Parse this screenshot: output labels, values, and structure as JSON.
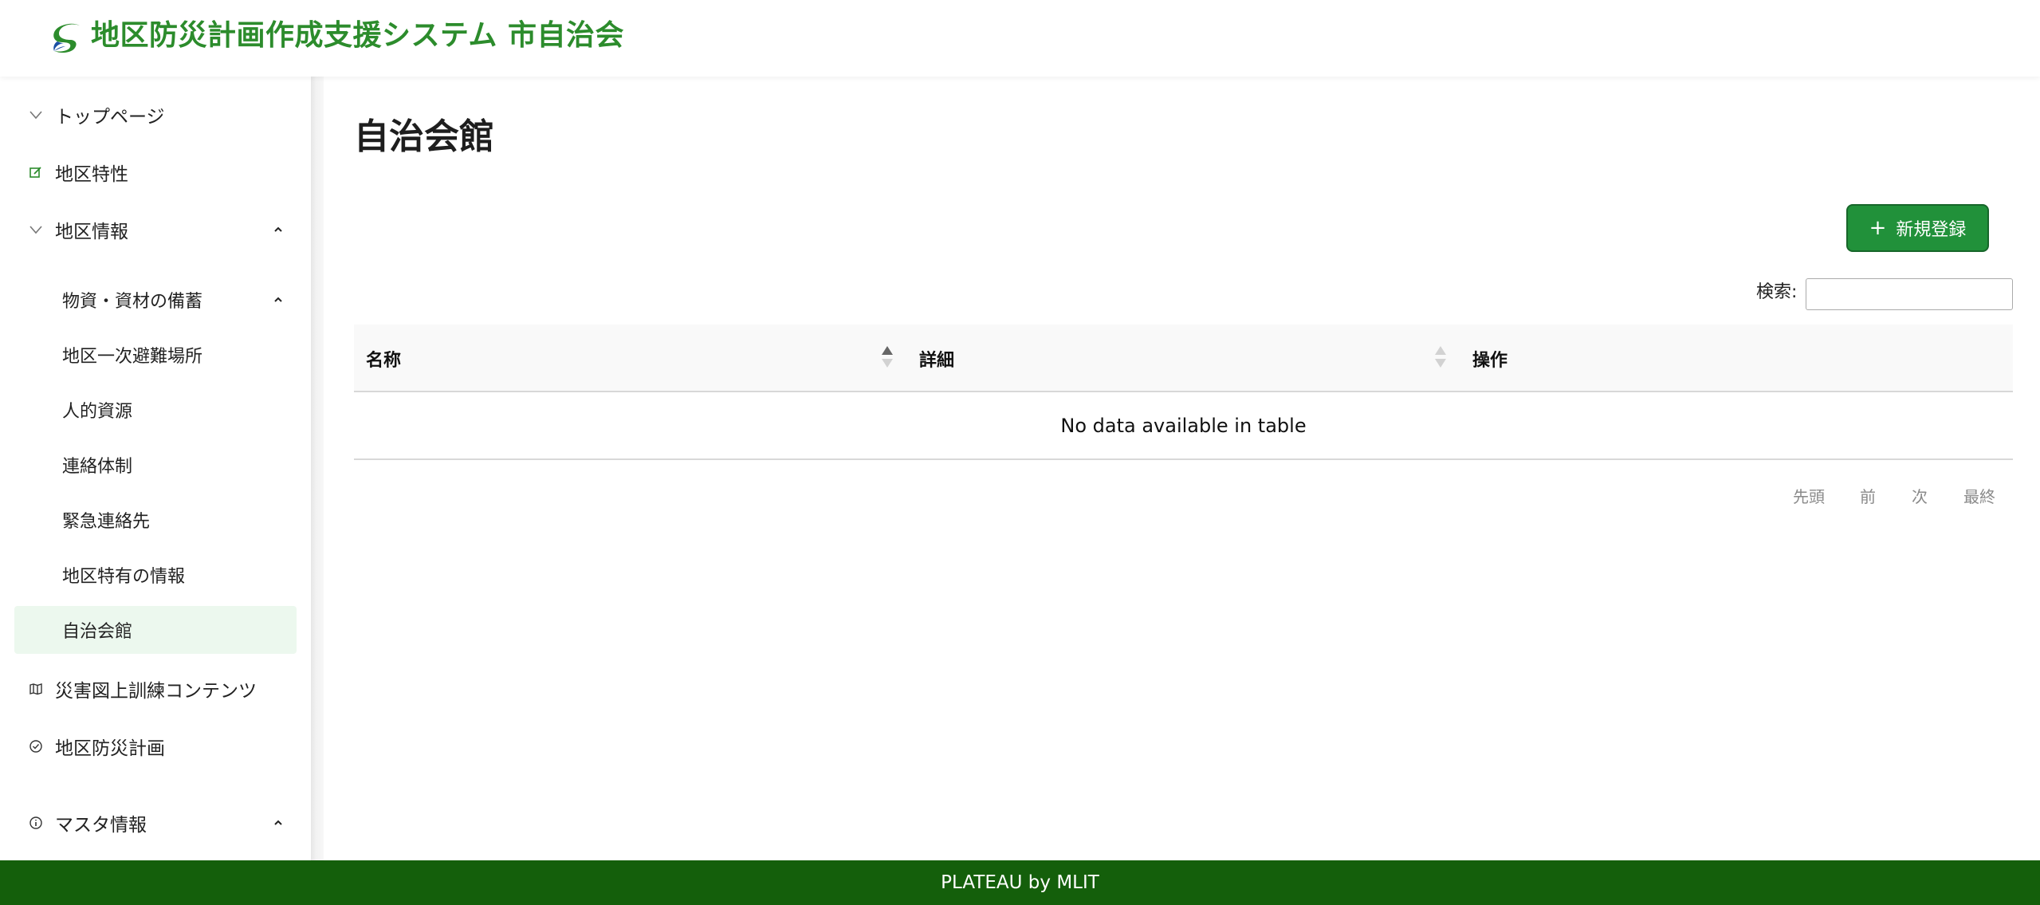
{
  "header": {
    "app_title": "地区防災計画作成支援システム 市自治会",
    "logo_icon": "swirl-logo-icon"
  },
  "sidebar": {
    "items": [
      {
        "label": "トップページ",
        "icon": "chevron-down-icon"
      },
      {
        "label": "地区特性",
        "icon": "edit-icon"
      },
      {
        "label": "地区情報",
        "icon": "chevron-down-icon",
        "expanded": true
      },
      {
        "label": "災害図上訓練コンテンツ",
        "icon": "map-icon"
      },
      {
        "label": "地区防災計画",
        "icon": "check-circle-icon"
      },
      {
        "label": "マスタ情報",
        "icon": "info-circle-icon",
        "expanded": true
      }
    ],
    "subitems": [
      {
        "label": "物資・資材の備蓄"
      },
      {
        "label": "地区一次避難場所"
      },
      {
        "label": "人的資源"
      },
      {
        "label": "連絡体制"
      },
      {
        "label": "緊急連絡先"
      },
      {
        "label": "地区特有の情報"
      },
      {
        "label": "自治会館",
        "active": true
      }
    ]
  },
  "main": {
    "page_title": "自治会館",
    "new_button": "新規登録",
    "search_label": "検索:",
    "search_value": "",
    "table": {
      "columns": [
        "名称",
        "詳細",
        "操作"
      ],
      "sorted_column": "名称",
      "empty_message": "No data available in table"
    },
    "pagination": {
      "first": "先頭",
      "prev": "前",
      "next": "次",
      "last": "最終"
    }
  },
  "footer": {
    "text": "PLATEAU by MLIT"
  },
  "colors": {
    "brand_green": "#2c8c2c",
    "button_green": "#21913a",
    "footer_green": "#145f0b",
    "active_bg": "#ecf8ee"
  }
}
